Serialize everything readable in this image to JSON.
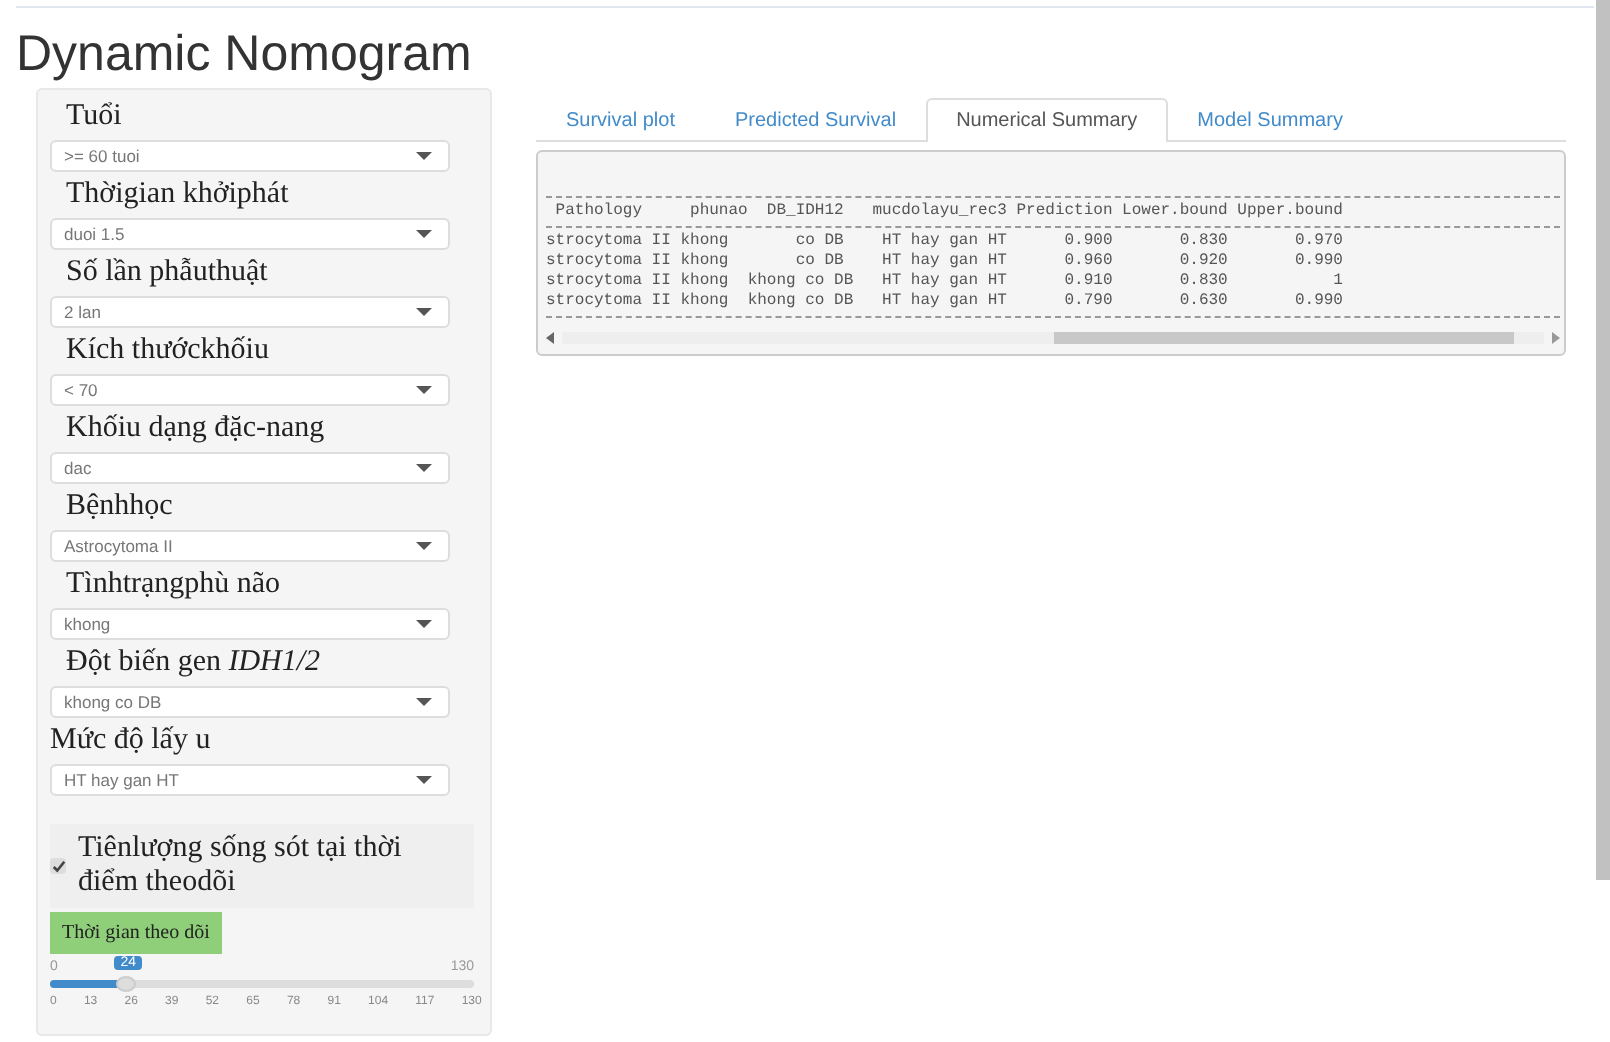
{
  "title": "Dynamic Nomogram",
  "inputs": [
    {
      "label": "Tuổi",
      "value": ">= 60 tuoi"
    },
    {
      "label": "Thờigian khởiphát",
      "value": "duoi 1.5"
    },
    {
      "label": "Số lần phẫuthuật",
      "value": "2 lan"
    },
    {
      "label": "Kích thướckhốiu",
      "value": "< 70"
    },
    {
      "label": "Khốiu dạng đặc-nang",
      "value": "dac"
    },
    {
      "label": "Bệnhhọc",
      "value": "Astrocytoma II"
    },
    {
      "label": "Tìnhtrạngphù não",
      "value": "khong"
    },
    {
      "label": "Đột biến gen *IDH1/2*",
      "value": "khong co DB"
    },
    {
      "label": "Mức độ lấy u",
      "value": "HT hay gan HT"
    }
  ],
  "checkbox": {
    "label": "Tiênlượng sống sót tại thời điểm theodõi",
    "checked": true
  },
  "slider": {
    "label": "Thời gian theo dõi",
    "min": "0",
    "max": "130",
    "value": "24",
    "level": 0.185,
    "ticks": [
      "0",
      "13",
      "26",
      "39",
      "52",
      "65",
      "78",
      "91",
      "104",
      "117",
      "130"
    ]
  },
  "tabs": [
    {
      "label": "Survival plot",
      "selected": false
    },
    {
      "label": "Predicted Survival",
      "selected": false
    },
    {
      "label": "Numerical Summary",
      "selected": true
    },
    {
      "label": "Model Summary",
      "selected": false
    }
  ],
  "output": {
    "header": " Pathology     phunao  DB_IDH12   mucdolayu_rec3 Prediction Lower.bound Upper.bound",
    "rows": [
      "strocytoma II khong       co DB    HT hay gan HT      0.900       0.830       0.970",
      "strocytoma II khong       co DB    HT hay gan HT      0.960       0.920       0.990",
      "strocytoma II khong  khong co DB   HT hay gan HT      0.910       0.830           1",
      "strocytoma II khong  khong co DB   HT hay gan HT      0.790       0.630       0.990"
    ]
  }
}
